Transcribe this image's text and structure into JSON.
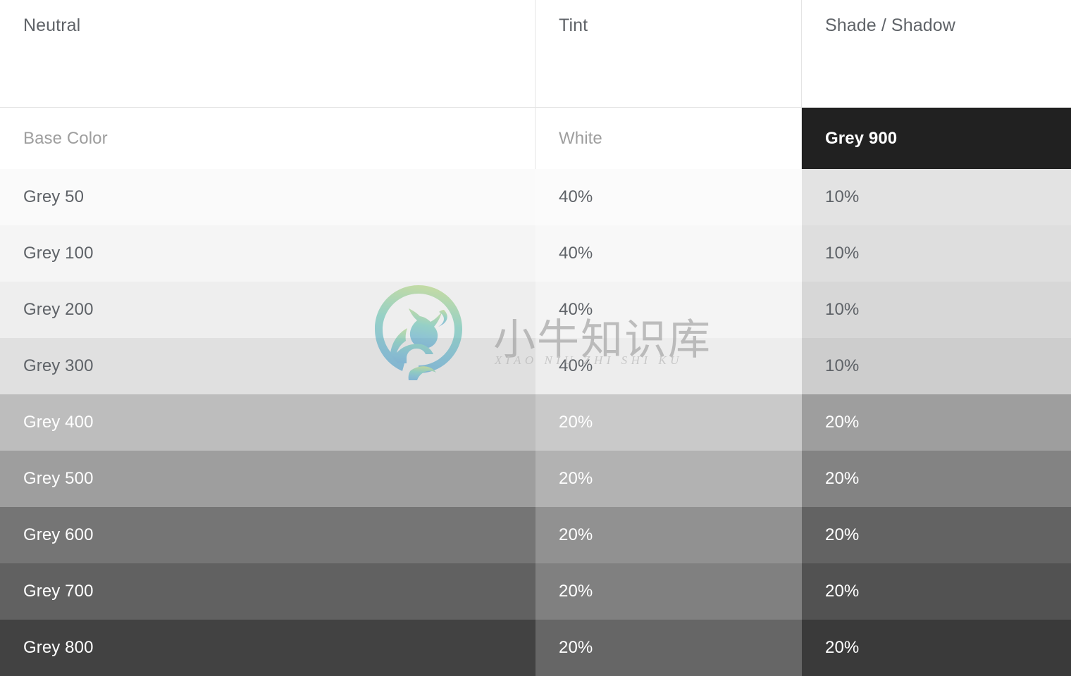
{
  "header": {
    "columns": [
      {
        "key": "neutral",
        "label": "Neutral"
      },
      {
        "key": "tint",
        "label": "Tint"
      },
      {
        "key": "shade",
        "label": "Shade / Shadow"
      }
    ]
  },
  "table": {
    "base_row": {
      "base_label": "Base Color",
      "tint_label": "White",
      "shade_label": "Grey 900",
      "base_bg": "#ffffff",
      "tint_bg": "#ffffff",
      "shade_bg": "#212121",
      "base_fg": "#9e9e9e",
      "tint_fg": "#9e9e9e",
      "shade_fg": "#ffffff"
    },
    "rows": [
      {
        "base_label": "Grey 50",
        "tint_label": "40%",
        "shade_label": "10%",
        "base_bg": "#fafafa",
        "tint_bg": "#fbfbfb",
        "shade_bg": "#e3e3e3",
        "base_fg": "#5f6368",
        "tint_fg": "#5f6368",
        "shade_fg": "#5f6368"
      },
      {
        "base_label": "Grey 100",
        "tint_label": "40%",
        "shade_label": "10%",
        "base_bg": "#f5f5f5",
        "tint_bg": "#f8f8f8",
        "shade_bg": "#dedede",
        "base_fg": "#5f6368",
        "tint_fg": "#5f6368",
        "shade_fg": "#5f6368"
      },
      {
        "base_label": "Grey 200",
        "tint_label": "40%",
        "shade_label": "10%",
        "base_bg": "#eeeeee",
        "tint_bg": "#f4f4f4",
        "shade_bg": "#d7d7d7",
        "base_fg": "#5f6368",
        "tint_fg": "#5f6368",
        "shade_fg": "#5f6368"
      },
      {
        "base_label": "Grey 300",
        "tint_label": "40%",
        "shade_label": "10%",
        "base_bg": "#e0e0e0",
        "tint_bg": "#ededed",
        "shade_bg": "#cdcdcd",
        "base_fg": "#5f6368",
        "tint_fg": "#5f6368",
        "shade_fg": "#5f6368"
      },
      {
        "base_label": "Grey 400",
        "tint_label": "20%",
        "shade_label": "20%",
        "base_bg": "#bdbdbd",
        "tint_bg": "#c9c9c9",
        "shade_bg": "#9e9e9e",
        "base_fg": "#ffffff",
        "tint_fg": "#ffffff",
        "shade_fg": "#ffffff"
      },
      {
        "base_label": "Grey 500",
        "tint_label": "20%",
        "shade_label": "20%",
        "base_bg": "#9e9e9e",
        "tint_bg": "#b2b2b2",
        "shade_bg": "#838383",
        "base_fg": "#ffffff",
        "tint_fg": "#ffffff",
        "shade_fg": "#ffffff"
      },
      {
        "base_label": "Grey 600",
        "tint_label": "20%",
        "shade_label": "20%",
        "base_bg": "#757575",
        "tint_bg": "#919191",
        "shade_bg": "#636363",
        "base_fg": "#ffffff",
        "tint_fg": "#ffffff",
        "shade_fg": "#ffffff"
      },
      {
        "base_label": "Grey 700",
        "tint_label": "20%",
        "shade_label": "20%",
        "base_bg": "#616161",
        "tint_bg": "#808080",
        "shade_bg": "#525252",
        "base_fg": "#ffffff",
        "tint_fg": "#ffffff",
        "shade_fg": "#ffffff"
      },
      {
        "base_label": "Grey 800",
        "tint_label": "20%",
        "shade_label": "20%",
        "base_bg": "#424242",
        "tint_bg": "#666666",
        "shade_bg": "#3a3a3a",
        "base_fg": "#ffffff",
        "tint_fg": "#ffffff",
        "shade_fg": "#ffffff"
      }
    ]
  },
  "watermark": {
    "icon": "bull-logo-icon",
    "text_cn": "小牛知识库",
    "text_en": "XIAO NIU ZHI SHI KU",
    "gradient_start": "#a8cf7a",
    "gradient_end": "#4a9ac8"
  }
}
